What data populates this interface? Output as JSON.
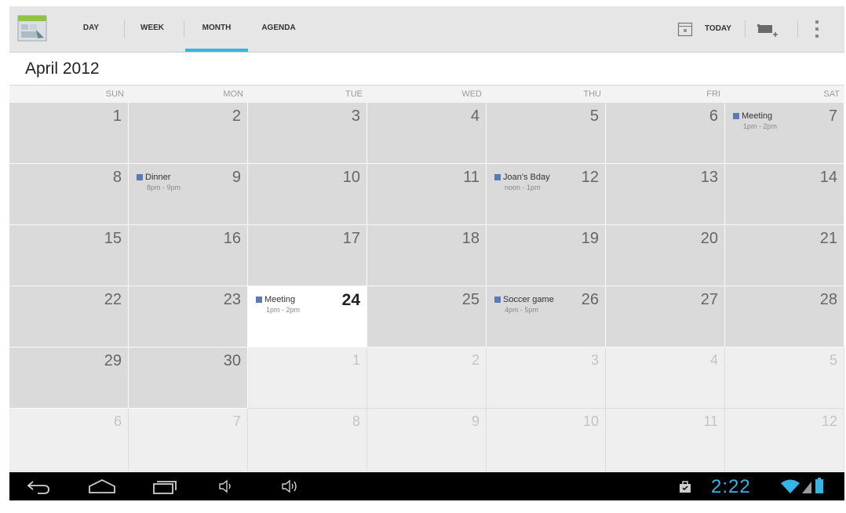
{
  "actionbar": {
    "app_icon": "calendar-app-icon",
    "tabs": [
      {
        "label": "DAY",
        "selected": false
      },
      {
        "label": "WEEK",
        "selected": false
      },
      {
        "label": "MONTH",
        "selected": true
      },
      {
        "label": "AGENDA",
        "selected": false
      }
    ],
    "today_label": "TODAY",
    "today_icon": "calendar-today-icon",
    "new_event_icon": "new-event-icon",
    "overflow_icon": "overflow-menu-icon",
    "accent_color": "#33b5e5"
  },
  "month_title": "April 2012",
  "weekdays": [
    "SUN",
    "MON",
    "TUE",
    "WED",
    "THU",
    "FRI",
    "SAT"
  ],
  "weeks": [
    [
      {
        "day": "1",
        "type": "cur"
      },
      {
        "day": "2",
        "type": "cur"
      },
      {
        "day": "3",
        "type": "cur"
      },
      {
        "day": "4",
        "type": "cur"
      },
      {
        "day": "5",
        "type": "cur"
      },
      {
        "day": "6",
        "type": "cur"
      },
      {
        "day": "7",
        "type": "cur",
        "event": {
          "title": "Meeting",
          "time": "1pm - 2pm"
        }
      }
    ],
    [
      {
        "day": "8",
        "type": "cur"
      },
      {
        "day": "9",
        "type": "cur",
        "event": {
          "title": "Dinner",
          "time": "8pm - 9pm"
        }
      },
      {
        "day": "10",
        "type": "cur"
      },
      {
        "day": "11",
        "type": "cur"
      },
      {
        "day": "12",
        "type": "cur",
        "event": {
          "title": "Joan's Bday",
          "time": "noon - 1pm"
        }
      },
      {
        "day": "13",
        "type": "cur"
      },
      {
        "day": "14",
        "type": "cur"
      }
    ],
    [
      {
        "day": "15",
        "type": "cur"
      },
      {
        "day": "16",
        "type": "cur"
      },
      {
        "day": "17",
        "type": "cur"
      },
      {
        "day": "18",
        "type": "cur"
      },
      {
        "day": "19",
        "type": "cur"
      },
      {
        "day": "20",
        "type": "cur"
      },
      {
        "day": "21",
        "type": "cur"
      }
    ],
    [
      {
        "day": "22",
        "type": "cur"
      },
      {
        "day": "23",
        "type": "cur"
      },
      {
        "day": "24",
        "type": "today",
        "event": {
          "title": "Meeting",
          "time": "1pm - 2pm"
        }
      },
      {
        "day": "25",
        "type": "cur"
      },
      {
        "day": "26",
        "type": "cur",
        "event": {
          "title": "Soccer game",
          "time": "4pm - 5pm"
        }
      },
      {
        "day": "27",
        "type": "cur"
      },
      {
        "day": "28",
        "type": "cur"
      }
    ],
    [
      {
        "day": "29",
        "type": "cur"
      },
      {
        "day": "30",
        "type": "cur"
      },
      {
        "day": "1",
        "type": "out"
      },
      {
        "day": "2",
        "type": "out"
      },
      {
        "day": "3",
        "type": "out"
      },
      {
        "day": "4",
        "type": "out"
      },
      {
        "day": "5",
        "type": "out"
      }
    ],
    [
      {
        "day": "6",
        "type": "out"
      },
      {
        "day": "7",
        "type": "out"
      },
      {
        "day": "8",
        "type": "out"
      },
      {
        "day": "9",
        "type": "out"
      },
      {
        "day": "10",
        "type": "out"
      },
      {
        "day": "11",
        "type": "out"
      },
      {
        "day": "12",
        "type": "out"
      }
    ]
  ],
  "event_color": "#5b79b8",
  "navbar": {
    "buttons": [
      "back-icon",
      "home-icon",
      "recent-apps-icon",
      "volume-down-icon",
      "volume-up-icon"
    ],
    "clock": "2:22",
    "status_icons": [
      "shopping-bag-icon",
      "wifi-icon",
      "signal-icon",
      "battery-icon"
    ]
  }
}
